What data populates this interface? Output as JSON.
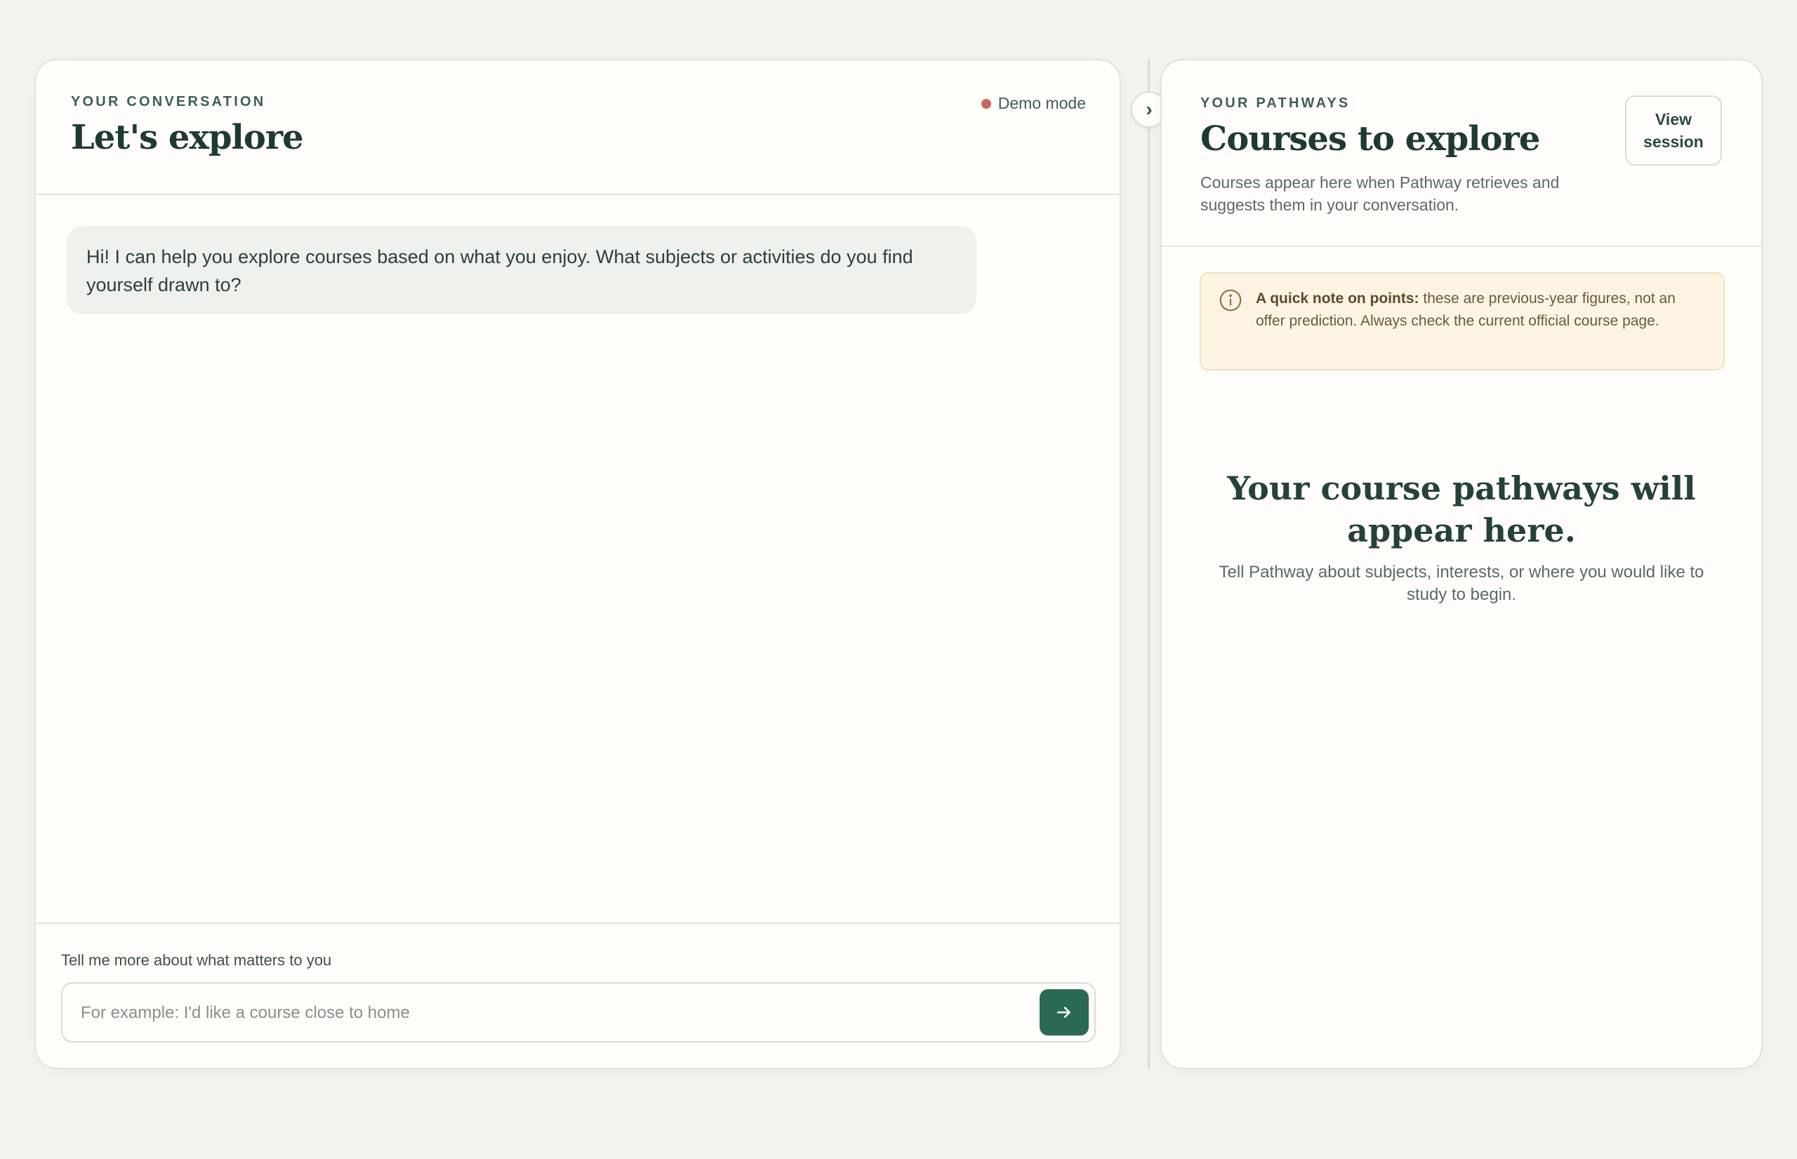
{
  "conversation": {
    "eyebrow": "YOUR CONVERSATION",
    "title": "Let's explore",
    "status": {
      "label": "Demo mode",
      "dot_color": "#c8675e"
    },
    "messages": [
      {
        "role": "assistant",
        "text": "Hi! I can help you explore courses based on what you enjoy. What subjects or activities do you find yourself drawn to?"
      }
    ],
    "composer": {
      "label": "Tell me more about what matters to you",
      "placeholder": "For example: I'd like a course close to home",
      "send_icon": "arrow-right-icon"
    }
  },
  "splitter": {
    "toggle_glyph": "›",
    "toggle_icon": "chevron-right-icon"
  },
  "pathways": {
    "eyebrow": "YOUR PATHWAYS",
    "title": "Courses to explore",
    "subtitle": "Courses appear here when Pathway retrieves and suggests them in your conversation.",
    "view_session_label": "View session",
    "note": {
      "icon": "info-icon",
      "bold": "A quick note on points:",
      "text": " these are previous-year figures, not an offer prediction. Always check the current official course page."
    },
    "empty_state": {
      "title": "Your course pathways will appear here.",
      "subtitle": "Tell Pathway about subjects, interests, or where you would like to study to begin."
    }
  },
  "colors": {
    "accent": "#2a6a55",
    "background": "#f4f3ef",
    "panel": "#fefdf9",
    "message_bubble": "#eff2ec",
    "note_background": "#fcf3e3"
  }
}
